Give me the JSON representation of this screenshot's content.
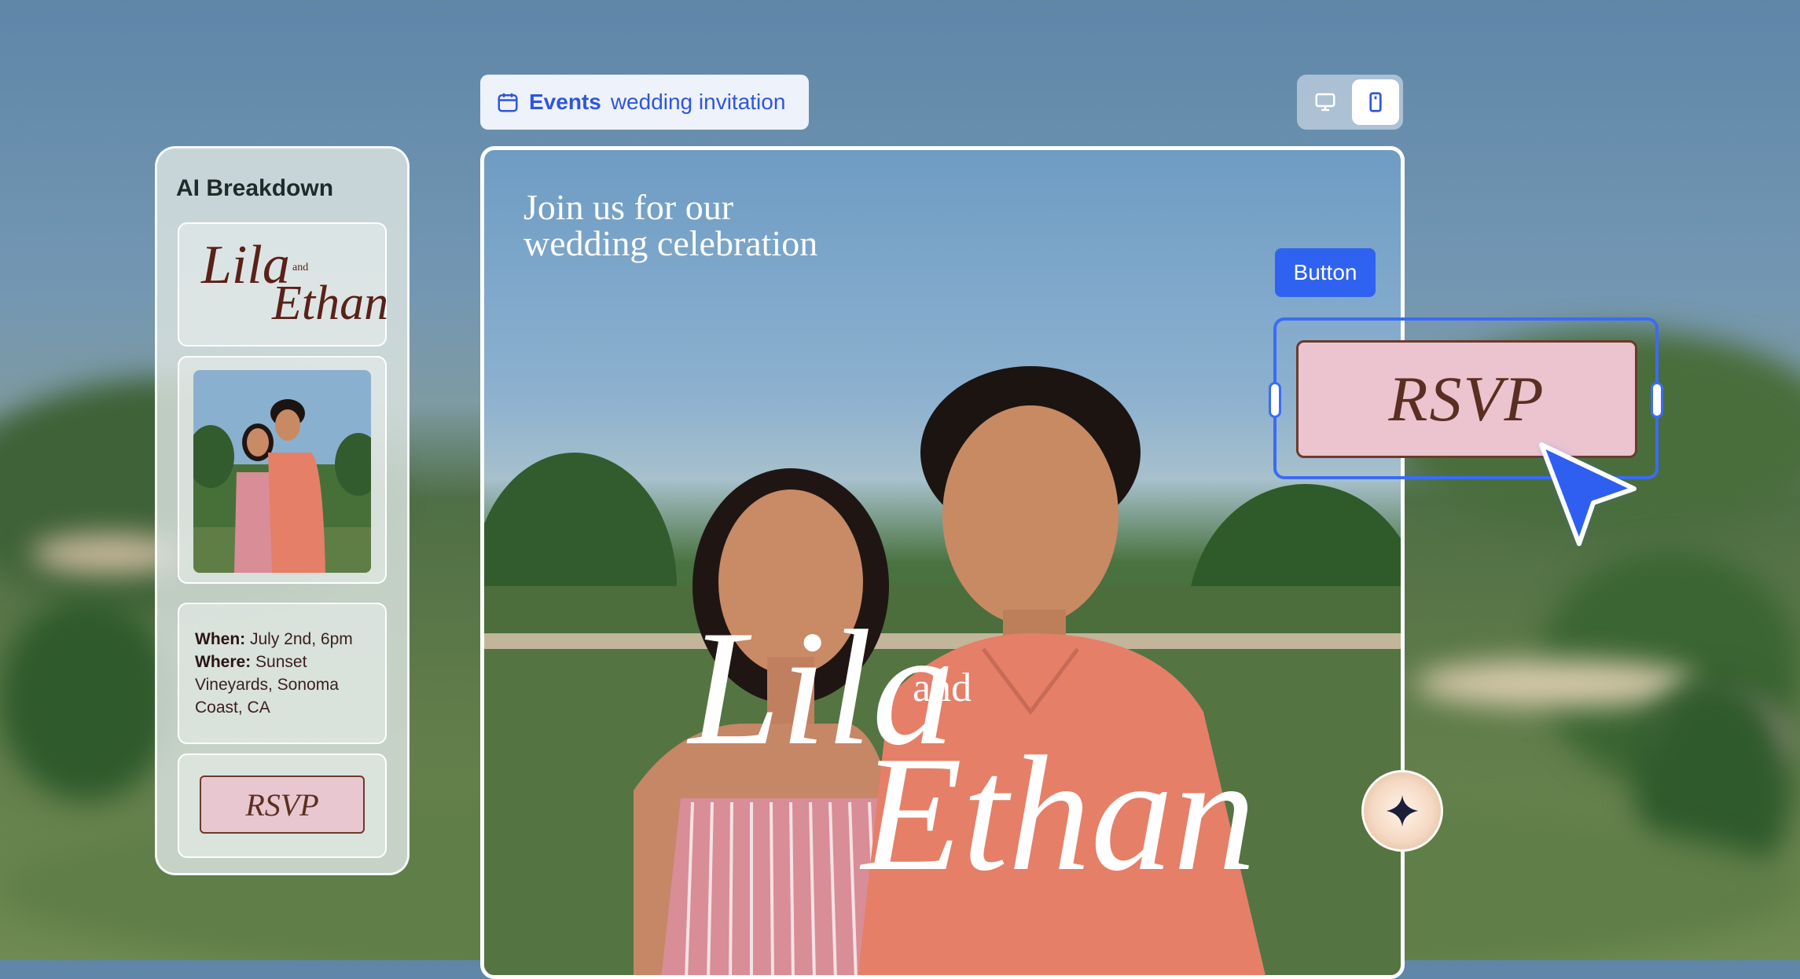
{
  "header": {
    "chip_strong": "Events",
    "chip_light": "wedding invitation"
  },
  "device_toggle": {
    "desktop_icon": "desktop-icon",
    "mobile_icon": "mobile-icon",
    "active": "mobile"
  },
  "canvas": {
    "heading": "Join us for our\nwedding celebration",
    "name_first": "Lila",
    "name_and": "and",
    "name_second": "Ethan"
  },
  "panel": {
    "title": "AI Breakdown",
    "names_first": "Lila",
    "names_and": "and",
    "names_second": "Ethan",
    "when_label": "When:",
    "when_value": "July 2nd, 6pm",
    "where_label": "Where:",
    "where_value": "Sunset Vineyards, Sonoma Coast, CA",
    "rsvp_label": "RSVP"
  },
  "selection": {
    "tag_label": "Button",
    "rsvp_label": "RSVP"
  },
  "colors": {
    "accent": "#2f62f0",
    "rsvp_fill": "#ebc4cf",
    "rsvp_border": "#6b3b2b",
    "script_text": "#5a2f22"
  }
}
